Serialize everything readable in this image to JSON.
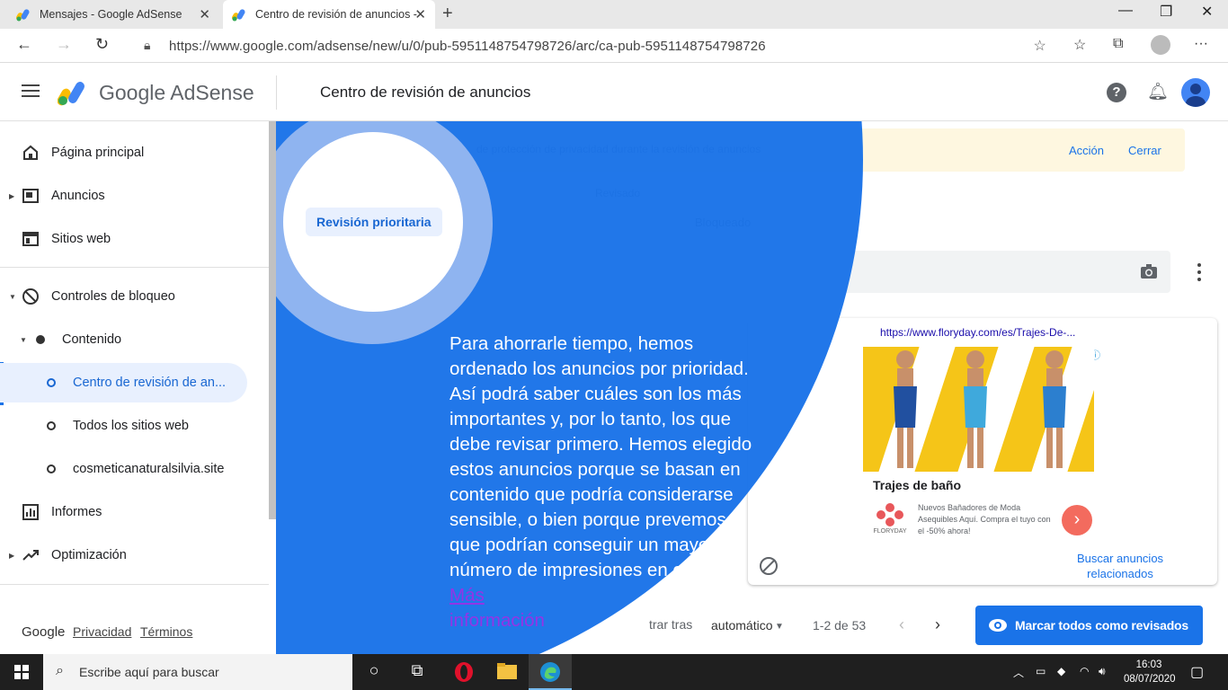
{
  "browser": {
    "tabs": [
      {
        "title": "Mensajes - Google AdSense"
      },
      {
        "title": "Centro de revisión de anuncios -"
      }
    ],
    "url": "https://www.google.com/adsense/new/u/0/pub-5951148754798726/arc/ca-pub-5951148754798726"
  },
  "header": {
    "brand": "Google AdSense",
    "page_title": "Centro de revisión de anuncios",
    "help_label": "?"
  },
  "sidebar": {
    "items": [
      {
        "label": "Página principal"
      },
      {
        "label": "Anuncios"
      },
      {
        "label": "Sitios web"
      },
      {
        "label": "Controles de bloqueo"
      },
      {
        "label": "Contenido"
      },
      {
        "label": "Centro de revisión de an..."
      },
      {
        "label": "Todos los sitios web"
      },
      {
        "label": "cosmeticanaturalsilvia.site"
      },
      {
        "label": "Informes"
      },
      {
        "label": "Optimización"
      }
    ],
    "footer": {
      "google": "Google",
      "privacy": "Privacidad",
      "terms": "Términos"
    }
  },
  "banner": {
    "text": "de protección de privacidad durante la revisión de anuncios",
    "action": "Acción",
    "close": "Cerrar"
  },
  "tabs": {
    "revisado": "Revisado",
    "bloqueado": "Bloqueado"
  },
  "ad": {
    "url": "https://www.floryday.com/es/Trajes-De-...",
    "info": "ⓘ",
    "title": "Trajes de baño",
    "description": "Nuevos Bañadores de Moda Asequibles Aquí. Compra el tuyo con el -50% ahora!",
    "brand": "FLORYDAY",
    "related": "Buscar anuncios relacionados"
  },
  "pagination": {
    "order_prefix": "trar tras",
    "order_value": "automático",
    "range": "1-2 de 53"
  },
  "mark_all_button": "Marcar todos como revisados",
  "feature_highlight": {
    "chip": "Revisión prioritaria",
    "text": "Para ahorrarle tiempo, hemos ordenado los anuncios por prioridad. Así podrá saber cuáles son los más importantes y, por lo tanto, los que debe revisar primero. Hemos elegido estos anuncios porque se basan en contenido que podría considerarse sensible, o bien porque prevemos que podrían conseguir un mayor número de impresiones en el futuro.",
    "more_a": "Más",
    "more_b": "información"
  },
  "taskbar": {
    "search_placeholder": "Escribe aquí para buscar",
    "time": "16:03",
    "date": "08/07/2020"
  },
  "colors": {
    "accent": "#1a73e8",
    "overlay": "#1a73e8",
    "banner": "#fef7e0"
  }
}
